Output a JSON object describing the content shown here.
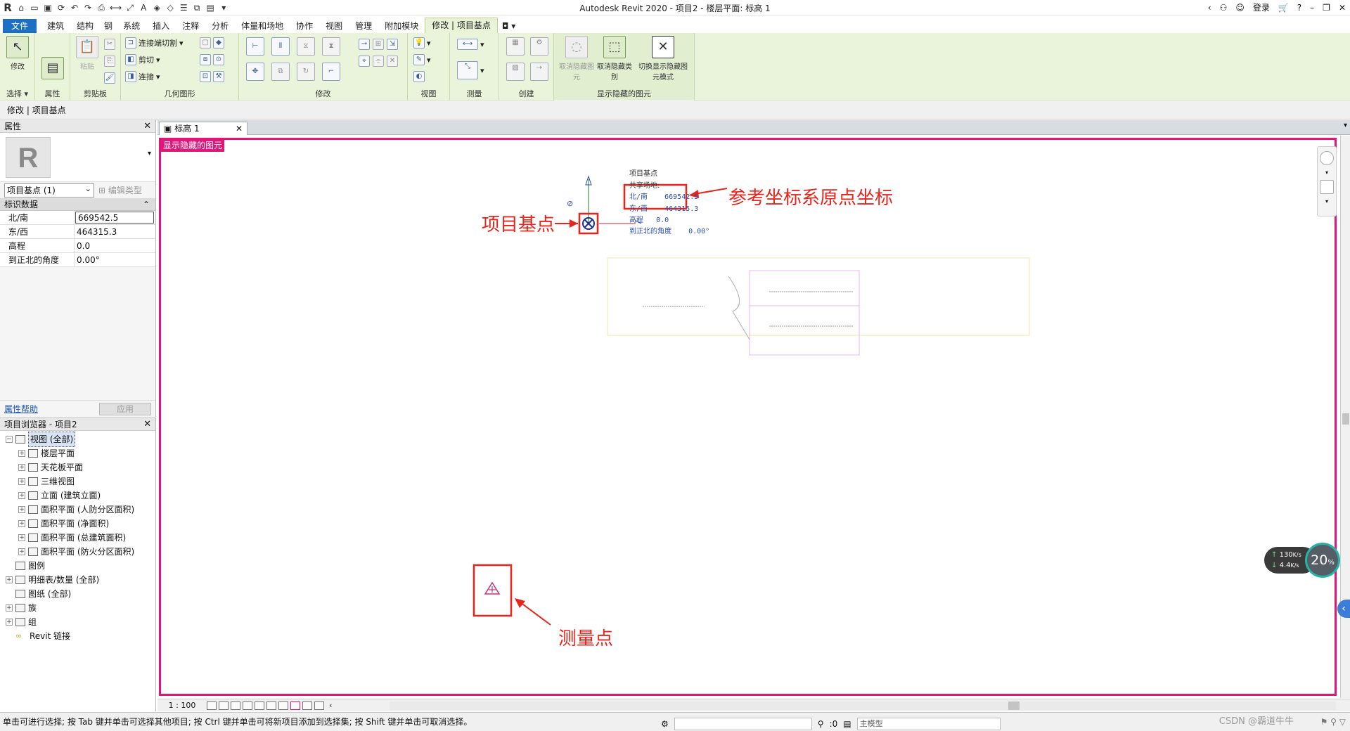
{
  "titlebar": {
    "app_title": "Autodesk Revit 2020 - 项目2 - 楼层平面: 标高 1",
    "login": "登录"
  },
  "ribbon_tabs": [
    "文件",
    "建筑",
    "结构",
    "钢",
    "系统",
    "插入",
    "注释",
    "分析",
    "体量和场地",
    "协作",
    "视图",
    "管理",
    "附加模块",
    "修改 | 项目基点"
  ],
  "ribbon": {
    "modify_label": "修改",
    "select_panel": "选择",
    "properties_panel": "属性",
    "clipboard_panel": "剪贴板",
    "paste_label": "粘贴",
    "geometry_panel": "几何图形",
    "cope_label": "连接端切割",
    "cut_label": "剪切",
    "join_label": "连接",
    "modify_panel": "修改",
    "view_panel": "视图",
    "measure_panel": "测量",
    "create_panel": "创建",
    "unhide_element": "取消隐藏图元",
    "unhide_category": "取消隐藏类别",
    "toggle_reveal": "切换显示隐藏图元模式",
    "reveal_panel": "显示隐藏的图元"
  },
  "options_bar": "修改 | 项目基点",
  "properties": {
    "title": "属性",
    "instance_selector": "项目基点 (1)",
    "edit_type": "编辑类型",
    "group": "标识数据",
    "rows": [
      {
        "key": "北/南",
        "value": "669542.5"
      },
      {
        "key": "东/西",
        "value": "464315.3"
      },
      {
        "key": "高程",
        "value": "0.0"
      },
      {
        "key": "到正北的角度",
        "value": "0.00°"
      }
    ],
    "help": "属性帮助",
    "apply": "应用"
  },
  "browser": {
    "title": "项目浏览器 - 项目2",
    "items": [
      {
        "label": "视图 (全部)",
        "level": 0,
        "toggle": "−"
      },
      {
        "label": "楼层平面",
        "level": 1,
        "toggle": "+"
      },
      {
        "label": "天花板平面",
        "level": 1,
        "toggle": "+"
      },
      {
        "label": "三维视图",
        "level": 1,
        "toggle": "+"
      },
      {
        "label": "立面 (建筑立面)",
        "level": 1,
        "toggle": "+"
      },
      {
        "label": "面积平面 (人防分区面积)",
        "level": 1,
        "toggle": "+"
      },
      {
        "label": "面积平面 (净面积)",
        "level": 1,
        "toggle": "+"
      },
      {
        "label": "面积平面 (总建筑面积)",
        "level": 1,
        "toggle": "+"
      },
      {
        "label": "面积平面 (防火分区面积)",
        "level": 1,
        "toggle": "+"
      },
      {
        "label": "图例",
        "level": 0,
        "toggle": ""
      },
      {
        "label": "明细表/数量 (全部)",
        "level": 0,
        "toggle": "+"
      },
      {
        "label": "图纸 (全部)",
        "level": 0,
        "toggle": ""
      },
      {
        "label": "族",
        "level": 0,
        "toggle": "+"
      },
      {
        "label": "组",
        "level": 0,
        "toggle": "+"
      },
      {
        "label": "Revit 链接",
        "level": 0,
        "toggle": ""
      }
    ]
  },
  "view": {
    "tab": "标高 1",
    "hidden_badge": "显示隐藏的图元",
    "basepoint_title": "项目基点",
    "shared_site": "共享场地:",
    "ns_label": "北/南",
    "ns_value": "669542.5",
    "ew_label": "东/西",
    "ew_value": "464315.3",
    "elev_label": "高程",
    "elev_value": "0.0",
    "angle_label": "到正北的角度",
    "angle_value": "0.00°",
    "annot_ref": "参考坐标系原点坐标",
    "annot_base": "项目基点",
    "annot_survey": "测量点"
  },
  "viewbar": {
    "scale": "1 : 100"
  },
  "statusbar": {
    "hint": "单击可进行选择; 按 Tab 键并单击可选择其他项目; 按 Ctrl 键并单击可将新项目添加到选择集; 按 Shift 键并单击可取消选择。",
    "count": ":0",
    "model": "主模型",
    "watermark": "CSDN @霸道牛牛"
  },
  "speed": {
    "up": "130",
    "down": "4.4",
    "unit": "K/s",
    "percent": "20"
  },
  "colors": {
    "accent": "#e0177a",
    "annotation": "#e8241b",
    "ribbon_bg": "#eaf4da",
    "file_tab": "#1c6fc3"
  }
}
